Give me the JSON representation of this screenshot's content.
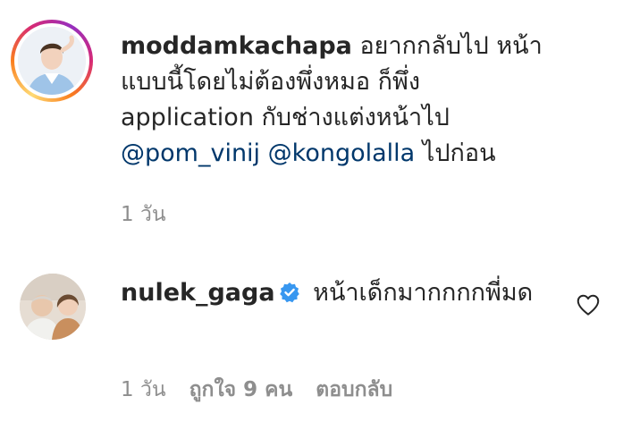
{
  "comments": [
    {
      "username": "moddamkachapa",
      "text_lines_start": " อยากกลับไป หน้าแบบนี้โดยไม่ต้องพึ่งหมอ ก็พึ่ง application กับช่างแต่งหน้าไป ",
      "text_lines": [
        " อยากกลับไป หน้า",
        "แบบนี้โดยไม่ต้องพึ่งหมอ ก็พึ่ง",
        "application กับช่างแต่งหน้าไป"
      ],
      "mention_1": "@pom_vinij",
      "mention_2": "@kongolalla",
      "text_end": " ไปก่อน",
      "time": "1 วัน"
    },
    {
      "username": "nulek_gaga",
      "verified": true,
      "text": " หน้าเด็กมากกกกพี่มด",
      "time": "1 วัน",
      "likes": "ถูกใจ 9 คน",
      "reply": "ตอบกลับ"
    }
  ],
  "colors": {
    "text": "#262626",
    "secondary": "#8e8e8e",
    "mention": "#00376b",
    "verified": "#3897f0"
  },
  "icons": {
    "heart": "heart-outline-icon",
    "verified": "verified-badge-icon"
  }
}
